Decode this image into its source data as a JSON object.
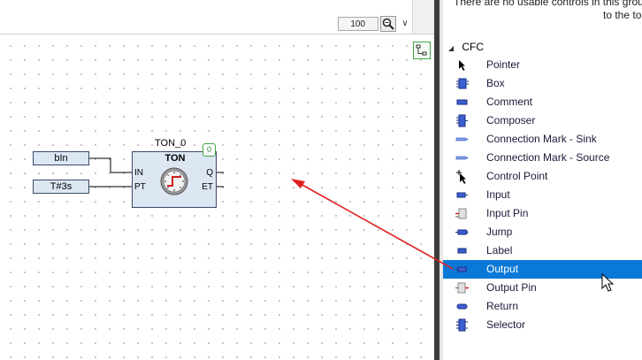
{
  "toolbox": {
    "notice_line1": "There are no usable controls in this grou",
    "notice_line2": "to the to",
    "category": "CFC",
    "items": [
      {
        "label": "Pointer",
        "icon": "pointer-icon"
      },
      {
        "label": "Box",
        "icon": "box-icon"
      },
      {
        "label": "Comment",
        "icon": "comment-icon"
      },
      {
        "label": "Composer",
        "icon": "composer-icon"
      },
      {
        "label": "Connection Mark - Sink",
        "icon": "connection-mark-sink-icon"
      },
      {
        "label": "Connection Mark - Source",
        "icon": "connection-mark-source-icon"
      },
      {
        "label": "Control Point",
        "icon": "control-point-icon"
      },
      {
        "label": "Input",
        "icon": "input-icon"
      },
      {
        "label": "Input Pin",
        "icon": "input-pin-icon"
      },
      {
        "label": "Jump",
        "icon": "jump-icon"
      },
      {
        "label": "Label",
        "icon": "label-icon"
      },
      {
        "label": "Output",
        "icon": "output-icon",
        "selected": true
      },
      {
        "label": "Output Pin",
        "icon": "output-pin-icon"
      },
      {
        "label": "Return",
        "icon": "return-icon"
      },
      {
        "label": "Selector",
        "icon": "selector-icon"
      }
    ],
    "selection_color": "#0a78d7"
  },
  "editor": {
    "zoom": "100",
    "variables": {
      "in": "bIn",
      "pt": "T#3s"
    },
    "block": {
      "instance": "TON_0",
      "type": "TON",
      "order": "0",
      "pins": {
        "in": "IN",
        "pt": "PT",
        "q": "Q",
        "et": "ET"
      }
    },
    "annotation_color": "#e02020"
  }
}
